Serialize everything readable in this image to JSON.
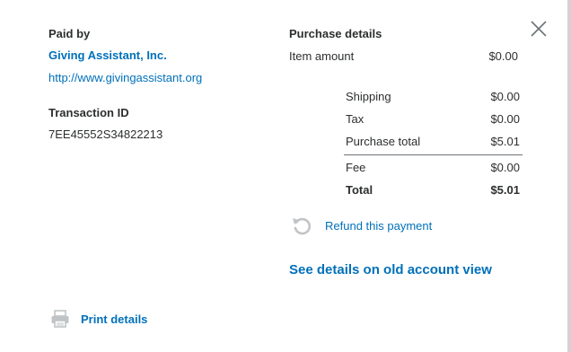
{
  "paid_by": {
    "label": "Paid by",
    "name": "Giving Assistant, Inc.",
    "url": "http://www.givingassistant.org"
  },
  "transaction": {
    "label": "Transaction ID",
    "id": "7EE45552S34822213"
  },
  "purchase_details": {
    "label": "Purchase details",
    "item_amount_label": "Item amount",
    "item_amount_value": "$0.00",
    "rows": [
      {
        "label": "Shipping",
        "value": "$0.00"
      },
      {
        "label": "Tax",
        "value": "$0.00"
      },
      {
        "label": "Purchase total",
        "value": "$5.01"
      }
    ],
    "fee_label": "Fee",
    "fee_value": "$0.00",
    "total_label": "Total",
    "total_value": "$5.01"
  },
  "actions": {
    "refund_label": "Refund this payment",
    "old_view_label": "See details on old account view",
    "print_label": "Print details"
  },
  "icons": {
    "close": "close-icon",
    "refund": "refresh-icon",
    "print": "printer-icon"
  },
  "colors": {
    "link": "#0070ba",
    "text": "#2c2e2f",
    "icon_gray": "#c0c4c7"
  }
}
